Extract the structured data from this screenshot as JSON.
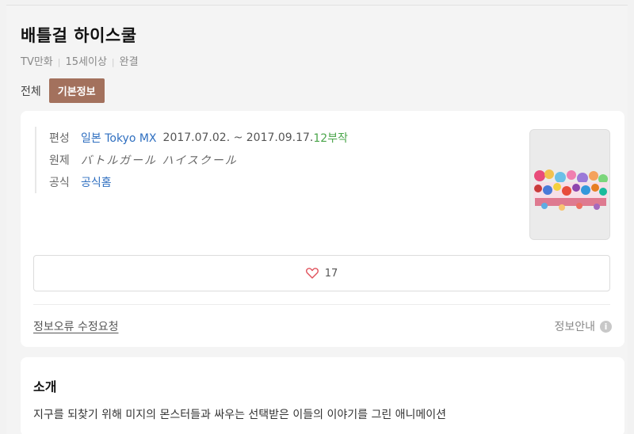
{
  "title": "배틀걸 하이스쿨",
  "meta": [
    "TV만화",
    "15세이상",
    "완결"
  ],
  "tabs": {
    "all": "전체",
    "basic": "기본정보"
  },
  "info": {
    "broadcast_label": "편성",
    "broadcaster": "일본 Tokyo MX",
    "dates": "2017.07.02. ~ 2017.09.17.",
    "episodes": "12부작",
    "original_label": "원제",
    "original_title": "バトルガール ハイスクール",
    "official_label": "공식",
    "official_link": "공식홈"
  },
  "like": {
    "count": "17",
    "color": "#e0505a"
  },
  "footer": {
    "report": "정보오류 수정요청",
    "guide": "정보안내",
    "guide_icon": "i"
  },
  "intro": {
    "heading": "소개",
    "text": "지구를 되찾기 위해 미지의 몬스터들과 싸우는 선택받은 이들의 이야기를 그린 애니메이션"
  },
  "colors": {
    "accent": "#a3715d",
    "link": "#2f6fc0",
    "episodes": "#4aa54a"
  }
}
